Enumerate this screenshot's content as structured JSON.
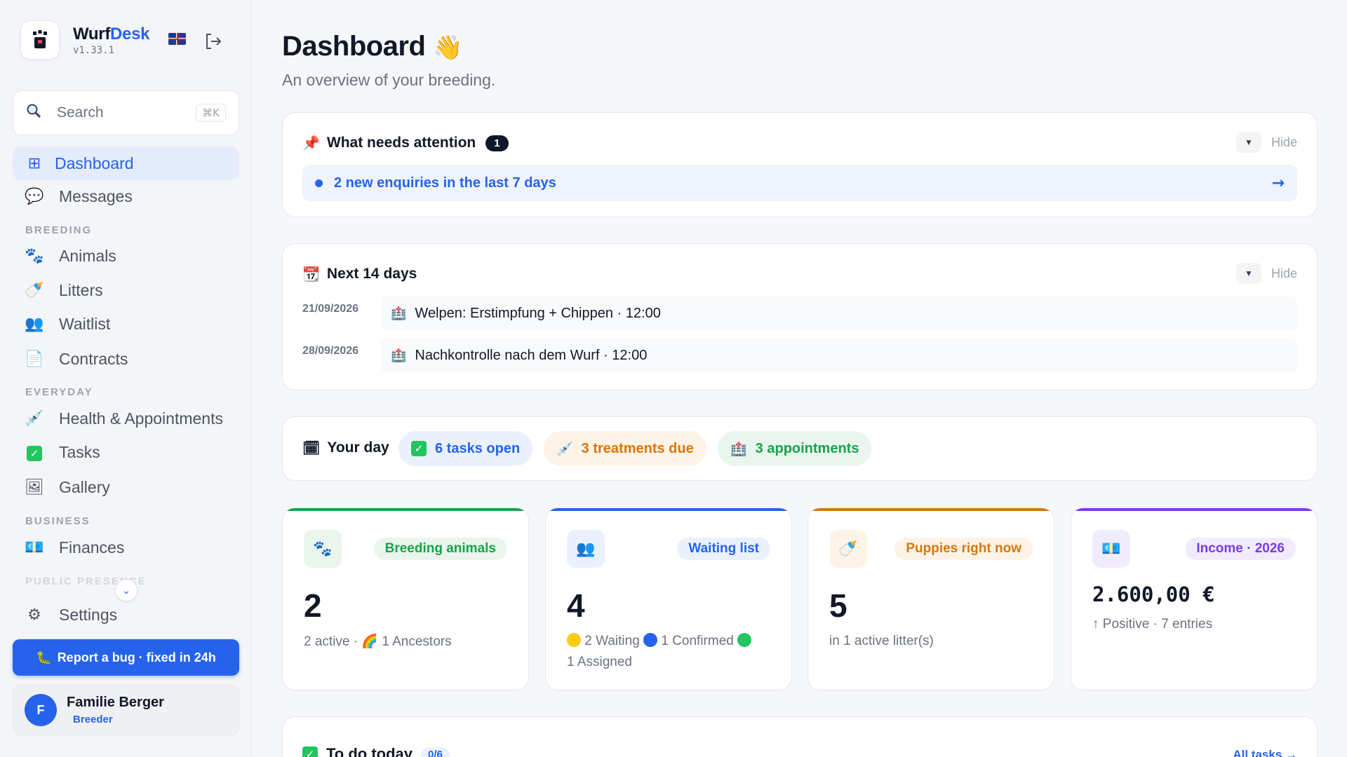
{
  "brand": {
    "name_part1": "Wurf",
    "name_part2": "Desk",
    "version": "v1.33.1"
  },
  "search": {
    "label": "Search",
    "shortcut": "⌘K"
  },
  "nav": {
    "dashboard": "Dashboard",
    "messages": "Messages",
    "section_breeding": "BREEDING",
    "animals": "Animals",
    "litters": "Litters",
    "waitlist": "Waitlist",
    "contracts": "Contracts",
    "section_everyday": "EVERYDAY",
    "health": "Health & Appointments",
    "tasks": "Tasks",
    "gallery": "Gallery",
    "section_business": "BUSINESS",
    "finances": "Finances",
    "section_public": "PUBLIC PRESENCE",
    "settings": "Settings"
  },
  "bug_button": "Report a bug · fixed in 24h",
  "user": {
    "initial": "F",
    "name": "Familie Berger",
    "role": "Breeder"
  },
  "header": {
    "title": "Dashboard",
    "subtitle": "An overview of your breeding."
  },
  "attention": {
    "title": "What needs attention",
    "count": "1",
    "hide": "Hide",
    "items": [
      "2 new enquiries in the last 7 days"
    ]
  },
  "next_days": {
    "title": "Next 14 days",
    "hide": "Hide",
    "events": [
      {
        "date": "21/09/2026",
        "text": "Welpen: Erstimpfung + Chippen · 12:00"
      },
      {
        "date": "28/09/2026",
        "text": "Nachkontrolle nach dem Wurf · 12:00"
      }
    ]
  },
  "your_day": {
    "title": "Your day",
    "tasks": "6 tasks open",
    "treatments": "3 treatments due",
    "appointments": "3 appointments"
  },
  "stats": {
    "breeding": {
      "label": "Breeding animals",
      "value": "2",
      "sub_a": "2 active · ",
      "sub_b": " 1 Ancestors",
      "color": "#16a34a"
    },
    "waiting": {
      "label": "Waiting list",
      "value": "4",
      "waiting": " 2 Waiting ",
      "confirmed": " 1 Confirmed ",
      "assigned": "1 Assigned",
      "color": "#2563eb"
    },
    "puppies": {
      "label": "Puppies right now",
      "value": "5",
      "sub": "in 1 active litter(s)",
      "color": "#d97706"
    },
    "income": {
      "label": "Income · 2026",
      "value": "2.600,00 €",
      "sub": "↑ Positive · 7 entries",
      "color": "#7c3aed"
    }
  },
  "todo": {
    "title": "To do today",
    "count": "0/6",
    "all": "All tasks →"
  }
}
